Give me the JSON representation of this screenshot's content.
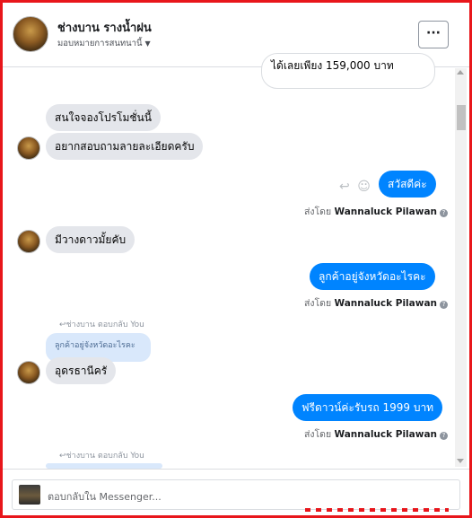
{
  "header": {
    "title": "ช่างบาน รางน้ำฝน",
    "subtitle": "มอบหมายการสนทนานี้",
    "more_label": "···"
  },
  "messages": {
    "partial_top": "ได้เลยเพียง 159,000 บาท",
    "in_1": "สนใจจองโปรโมชั่นนี้",
    "in_2": "อยากสอบถามลายละเอียดครับ",
    "out_1": "สวัสดีค่ะ",
    "sent_by_1_prefix": "ส่งโดย",
    "sent_by_1_name": "Wannaluck Pilawan",
    "in_3": "มีวางดาวมั้ยคับ",
    "out_2": "ลูกค้าอยู่จังหวัดอะไรคะ",
    "sent_by_2_prefix": "ส่งโดย",
    "sent_by_2_name": "Wannaluck Pilawan",
    "reply_label_1": "↩ช่างบาน ตอบกลับ You",
    "quoted_1": "ลูกค้าอยู่จังหวัดอะไรคะ",
    "in_4": "อุดรธานีครั",
    "out_3": "ฟรีดาวน์ค่ะรับรถ 1999 บาท",
    "sent_by_3_prefix": "ส่งโดย",
    "sent_by_3_name": "Wannaluck Pilawan",
    "reply_label_2": "↩ช่างบาน ตอบกลับ You"
  },
  "icons": {
    "reply": "reply-icon",
    "emoji": "emoji-icon",
    "info": "info-icon",
    "more": "more-icon"
  },
  "composer": {
    "placeholder": "ตอบกลับใน Messenger..."
  },
  "colors": {
    "outgoing_bubble": "#0084ff",
    "incoming_bubble": "#e4e6eb",
    "quoted_bubble": "#d9e8fb",
    "frame_border": "#e8161b"
  }
}
